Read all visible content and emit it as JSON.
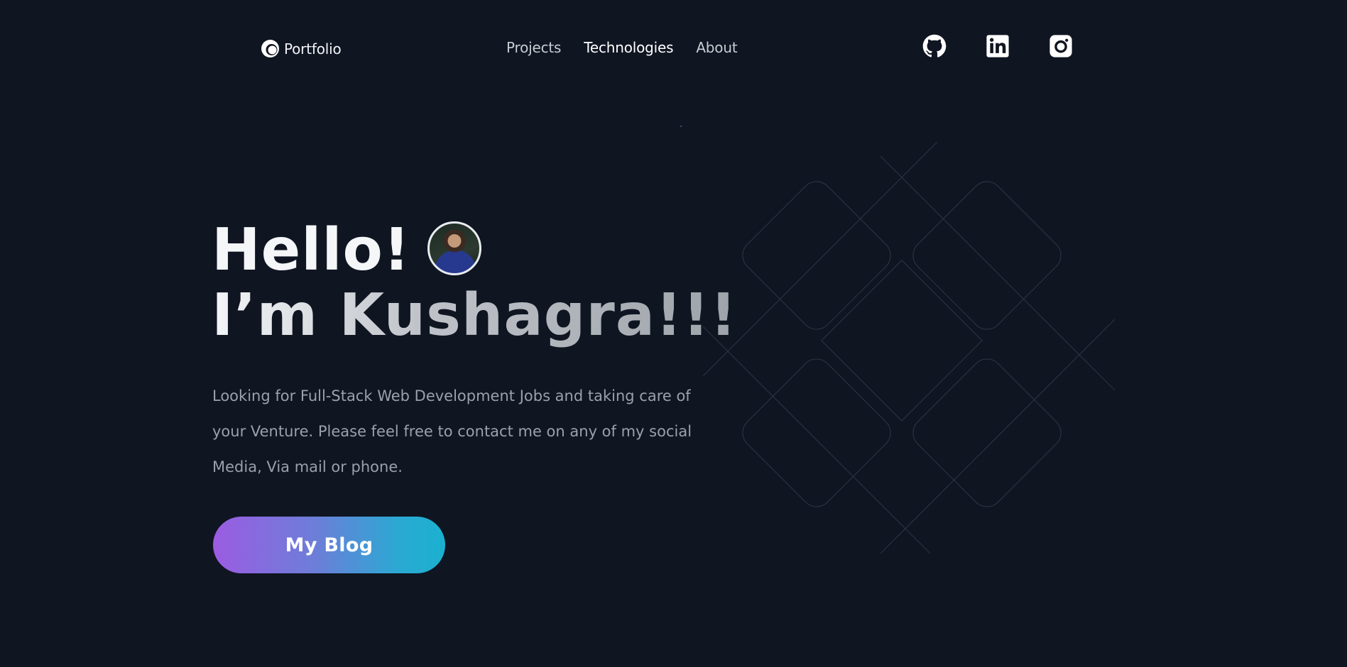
{
  "nav": {
    "logo_text": "Portfolio",
    "links": [
      {
        "label": "Projects"
      },
      {
        "label": "Technologies"
      },
      {
        "label": "About"
      }
    ],
    "social": [
      {
        "icon": "github-icon"
      },
      {
        "icon": "linkedin-icon"
      },
      {
        "icon": "instagram-icon"
      }
    ]
  },
  "hero": {
    "greeting": "Hello!",
    "name_line": "I’m Kushagra!!!",
    "description": "Looking for Full-Stack Web Development Jobs and taking care of your Venture. Please feel free to contact me on any of my social Media, Via mail or phone.",
    "cta_label": "My Blog"
  },
  "colors": {
    "background": "#0f1521",
    "text_primary": "#f4f6f8",
    "text_muted": "#9ba1ab",
    "cta_gradient_start": "#9b5ce2",
    "cta_gradient_end": "#1bb1cf"
  }
}
